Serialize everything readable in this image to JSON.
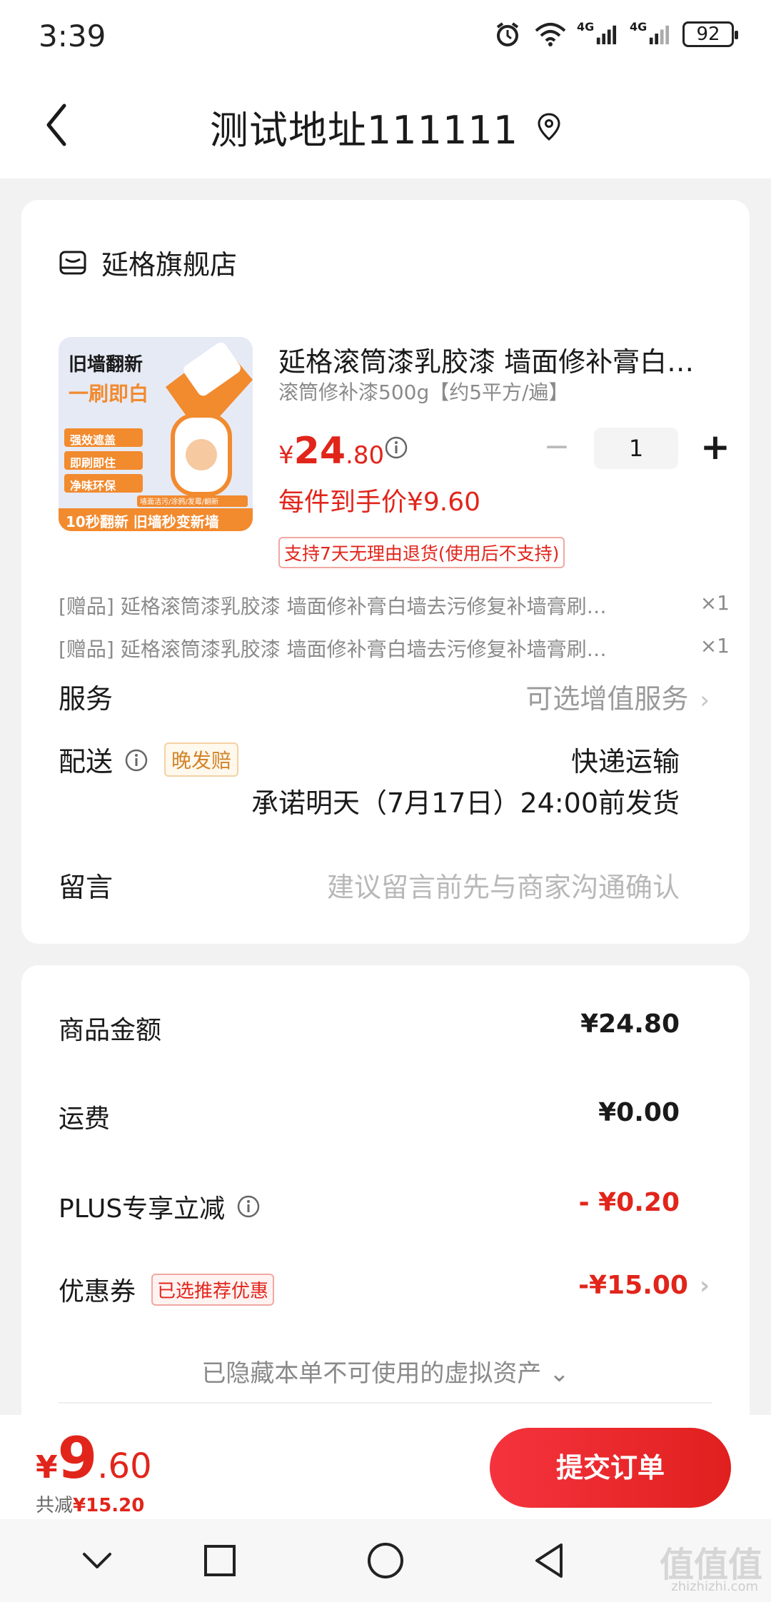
{
  "status_bar": {
    "time": "3:39",
    "network_1": "4G",
    "network_2": "4G",
    "battery": "92"
  },
  "header": {
    "title": "测试地址111111"
  },
  "shop": {
    "name": "延格旗舰店"
  },
  "product": {
    "title": "延格滚筒漆乳胶漆 墙面修补膏白…",
    "spec": "滚筒修补漆500g【约5平方/遍】",
    "price_yen": "¥",
    "price_int": "24",
    "price_dec": ".80",
    "quantity": "1",
    "minus": "−",
    "plus": "+",
    "final_price": "每件到手价¥9.60",
    "return_policy": "支持7天无理由退货(使用后不支持)",
    "image_text": {
      "line1": "旧墙翻新",
      "line2": "一刷即白",
      "f1": "强效遮盖",
      "f2": "即刷即住",
      "f3": "净味环保",
      "small": "墙面洁污/涂鸦/发霉/翻新",
      "bottom": "10秒翻新 旧墙秒变新墙"
    }
  },
  "gifts": [
    {
      "text": "[赠品]  延格滚筒漆乳胶漆 墙面修补膏白墙去污修复补墙膏刷…",
      "qty": "×1"
    },
    {
      "text": "[赠品]  延格滚筒漆乳胶漆 墙面修补膏白墙去污修复补墙膏刷…",
      "qty": "×1"
    }
  ],
  "service": {
    "label": "服务",
    "value": "可选增值服务",
    "chevron": "›"
  },
  "shipping": {
    "label": "配送",
    "tag": "晚发赔",
    "method": "快递运输",
    "promise": "承诺明天（7月17日）24:00前发货"
  },
  "message": {
    "label": "留言",
    "placeholder": "建议留言前先与商家沟通确认"
  },
  "summary": {
    "goods_label": "商品金额",
    "goods_value": "¥24.80",
    "freight_label": "运费",
    "freight_value": "¥0.00",
    "plus_label": "PLUS专享立减",
    "plus_value": "- ¥0.20",
    "coupon_label": "优惠券",
    "coupon_tag": "已选推荐优惠",
    "coupon_value": "-¥15.00",
    "coupon_chevron": "›",
    "hidden_assets": "已隐藏本单不可使用的虚拟资产 ⌄"
  },
  "bottom": {
    "total_yen": "¥",
    "total_int": "9",
    "total_dec": ".60",
    "saved_label": "共减",
    "saved_value": "¥15.20",
    "submit": "提交订单"
  },
  "watermark": {
    "main": "值值值",
    "sub": "zhizhizhi.com"
  },
  "colors": {
    "accent": "#e1251b",
    "tag_orange": "#d2842a",
    "muted": "#8a8a8a"
  }
}
